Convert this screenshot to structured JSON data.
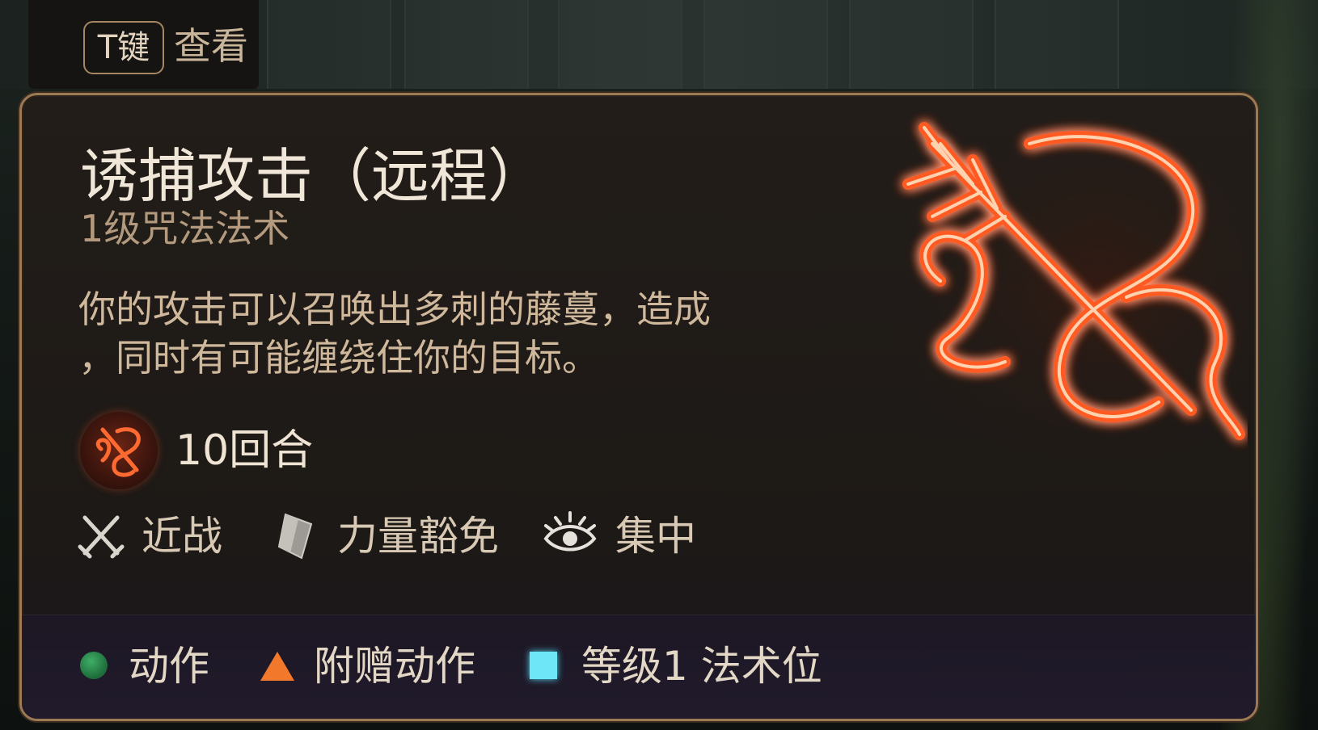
{
  "view_hint": {
    "key": "T键",
    "label": "查看"
  },
  "spell": {
    "title": "诱捕攻击（远程）",
    "subtitle": "1级咒法法术",
    "description": "你的攻击可以召唤出多刺的藤蔓，造成\n，同时有可能缠绕住你的目标。",
    "duration": "10回合",
    "icon": "thorn-vine-rune-icon",
    "tags": [
      {
        "label": "近战",
        "icon": "crossed-swords-icon"
      },
      {
        "label": "力量豁免",
        "icon": "shield-icon"
      },
      {
        "label": "集中",
        "icon": "concentration-eye-icon"
      }
    ],
    "costs": [
      {
        "label": "动作",
        "icon": "action-dot-icon",
        "color": "#2f9a5a"
      },
      {
        "label": "附赠动作",
        "icon": "bonus-action-triangle-icon",
        "color": "#f2792b"
      },
      {
        "label": "等级1 法术位",
        "icon": "spell-slot-square-icon",
        "color": "#6fe6f7"
      }
    ]
  },
  "colors": {
    "title": "#f1e7d9",
    "subtitle": "#b39a7e",
    "description": "#cfb89b",
    "border": "#9c7a54",
    "rune_glow": "#ff5a22"
  }
}
